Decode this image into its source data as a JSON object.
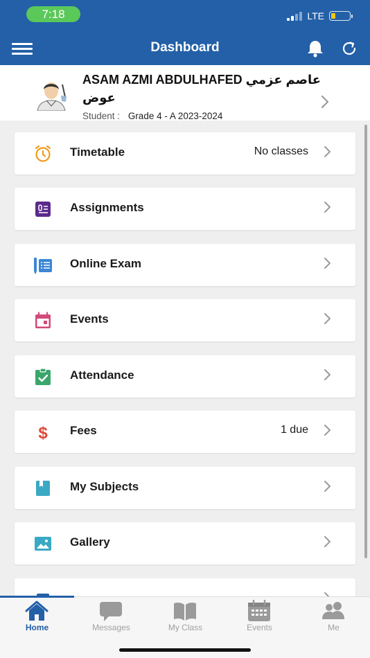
{
  "status_bar": {
    "time": "7:18",
    "network": "LTE",
    "time_badge_color": "#5bc85a",
    "battery_color": "#f5c518"
  },
  "header": {
    "title": "Dashboard",
    "background": "#2360a8",
    "icons": [
      "menu-icon",
      "bell-icon",
      "refresh-icon"
    ]
  },
  "profile": {
    "name": "ASAM AZMI ABDULHAFED عاصم عزمي عوض",
    "student_label": "Student :",
    "grade": "Grade 4 - A 2023-2024"
  },
  "menu": [
    {
      "label": "Timetable",
      "value": "No classes",
      "icon": "alarm-clock-icon",
      "color": "#f39a1c"
    },
    {
      "label": "Assignments",
      "value": "",
      "icon": "assignment-icon",
      "color": "#5b2a8c"
    },
    {
      "label": "Online Exam",
      "value": "",
      "icon": "online-exam-icon",
      "color": "#3b86d6"
    },
    {
      "label": "Events",
      "value": "",
      "icon": "calendar-icon",
      "color": "#d24a7a"
    },
    {
      "label": "Attendance",
      "value": "",
      "icon": "clipboard-check-icon",
      "color": "#3aa66a"
    },
    {
      "label": "Fees",
      "value": "1 due",
      "icon": "dollar-icon",
      "color": "#e0463a"
    },
    {
      "label": "My Subjects",
      "value": "",
      "icon": "book-icon",
      "color": "#3aa9c4"
    },
    {
      "label": "Gallery",
      "value": "",
      "icon": "image-icon",
      "color": "#3aa9c4"
    }
  ],
  "tabs": [
    {
      "label": "Home",
      "icon": "home-icon",
      "active": true
    },
    {
      "label": "Messages",
      "icon": "chat-icon",
      "active": false
    },
    {
      "label": "My Class",
      "icon": "open-book-icon",
      "active": false
    },
    {
      "label": "Events",
      "icon": "calendar-icon",
      "active": false
    },
    {
      "label": "Me",
      "icon": "people-icon",
      "active": false
    }
  ]
}
